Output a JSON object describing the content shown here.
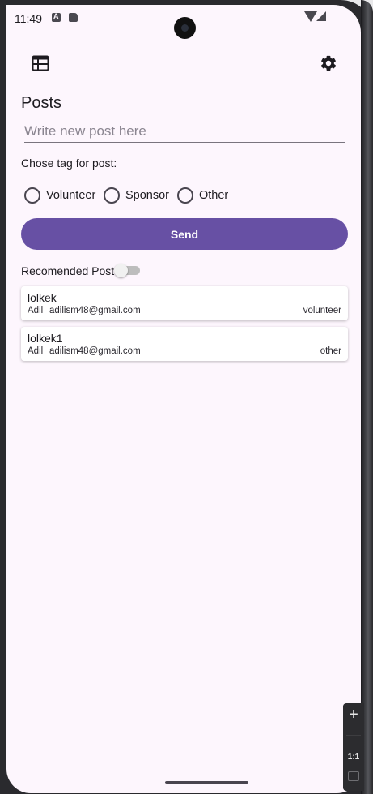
{
  "status_bar": {
    "time": "11:49"
  },
  "page": {
    "title": "Posts"
  },
  "post_input": {
    "placeholder": "Write new post here",
    "value": ""
  },
  "tag_selection": {
    "label": "Chose tag for post:",
    "options": [
      "Volunteer",
      "Sponsor",
      "Other"
    ],
    "selected": null
  },
  "send_button": {
    "label": "Send"
  },
  "recommended": {
    "label": "Recomended Post",
    "enabled": false
  },
  "posts": [
    {
      "title": "lolkek",
      "author": "Adil",
      "email": "adilism48@gmail.com",
      "tag": "volunteer"
    },
    {
      "title": "lolkek1",
      "author": "Adil",
      "email": "adilism48@gmail.com",
      "tag": "other"
    }
  ],
  "emulator_zoom": {
    "zoom_in": "+",
    "zoom_out": "—",
    "reset": "1:1"
  },
  "colors": {
    "primary": "#6750a4",
    "background": "#fdf6fd",
    "on_surface": "#1d1b20"
  },
  "icons": {
    "app_bar_left": "calendar-view-icon",
    "app_bar_right": "gear-icon"
  }
}
